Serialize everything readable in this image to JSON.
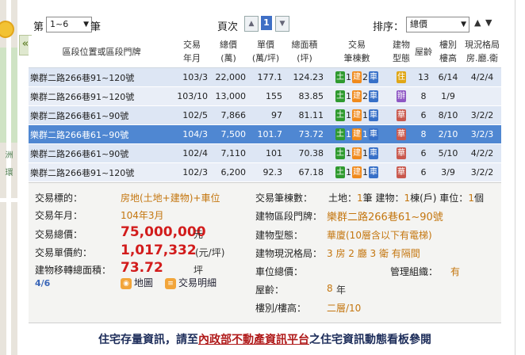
{
  "toolbar": {
    "page_prefix": "第",
    "page_range": "1~6",
    "page_suffix": "筆",
    "page_label": "頁次",
    "page_prev": "▲",
    "page_current": "1",
    "page_next": "▼",
    "sort_label": "排序：",
    "sort_value": "總價",
    "sort_asc": "▲",
    "sort_desc": "▼"
  },
  "columns": {
    "address": "區段位置或區段門牌",
    "date": [
      "交易",
      "年月"
    ],
    "total": [
      "總價",
      "(萬)"
    ],
    "unit_price": [
      "單價",
      "(萬/坪)"
    ],
    "area": [
      "總面積",
      "(坪)"
    ],
    "trans": [
      "交易",
      "筆棟數"
    ],
    "type": [
      "建物",
      "型態"
    ],
    "age": "屋齡",
    "floor": [
      "樓別",
      "樓高"
    ],
    "layout": [
      "現況格局",
      "房.廳.衛"
    ]
  },
  "rows": [
    {
      "address": "樂群二路266巷91~120號",
      "date": "103/3",
      "total": "22,000",
      "unit_price": "177.1",
      "area": "124.23",
      "land": "1",
      "land_tag": "土",
      "bldg": "2",
      "bldg_tag": "建",
      "car": "1",
      "car_tag": "車",
      "type_tag": "住",
      "age": "13",
      "floor": "6/14",
      "layout": "4/2/4"
    },
    {
      "address": "樂群二路266巷91~120號",
      "date": "103/10",
      "total": "13,000",
      "unit_price": "155",
      "area": "83.85",
      "land": "1",
      "land_tag": "土",
      "bldg": "2",
      "bldg_tag": "建",
      "car": "1",
      "car_tag": "車",
      "type_tag": "辦",
      "age": "8",
      "floor": "1/9",
      "layout": ""
    },
    {
      "address": "樂群二路266巷61~90號",
      "date": "102/5",
      "total": "7,866",
      "unit_price": "97",
      "area": "81.11",
      "land": "1",
      "land_tag": "土",
      "bldg": "1",
      "bldg_tag": "建",
      "car": "1",
      "car_tag": "車",
      "type_tag": "華",
      "age": "6",
      "floor": "8/10",
      "layout": "3/2/2"
    },
    {
      "address": "樂群二路266巷61~90號",
      "date": "104/3",
      "total": "7,500",
      "unit_price": "101.7",
      "area": "73.72",
      "land": "1",
      "land_tag": "土",
      "bldg": "1",
      "bldg_tag": "建",
      "car": "1",
      "car_tag": "車",
      "type_tag": "華",
      "age": "8",
      "floor": "2/10",
      "layout": "3/2/3"
    },
    {
      "address": "樂群二路266巷61~90號",
      "date": "102/4",
      "total": "7,110",
      "unit_price": "101",
      "area": "70.38",
      "land": "1",
      "land_tag": "土",
      "bldg": "1",
      "bldg_tag": "建",
      "car": "1",
      "car_tag": "車",
      "type_tag": "華",
      "age": "6",
      "floor": "5/10",
      "layout": "4/2/2"
    },
    {
      "address": "樂群二路266巷91~120號",
      "date": "102/3",
      "total": "6,200",
      "unit_price": "92.3",
      "area": "67.18",
      "land": "1",
      "land_tag": "土",
      "bldg": "1",
      "bldg_tag": "建",
      "car": "1",
      "car_tag": "車",
      "type_tag": "華",
      "age": "6",
      "floor": "3/9",
      "layout": "3/2/2"
    }
  ],
  "detail": {
    "target_label": "交易標的：",
    "target_value": "房地(土地+建物)+車位",
    "date_label": "交易年月：",
    "date_value": "104年3月",
    "total_label": "交易總價：",
    "total_value": "75,000,000",
    "total_unit": "元",
    "unit_label": "交易單價約：",
    "unit_value": "1,017,332",
    "unit_unit": "(元/坪)",
    "area_label": "建物移轉總面積：",
    "area_value": "73.72",
    "area_unit": "坪",
    "pager": "4/6",
    "map_btn": "地圖",
    "detail_btn": "交易明細",
    "count_label": "交易筆棟數：",
    "count_land_label": "土地：",
    "count_land": "1",
    "count_land_unit": "筆 建物：",
    "count_bldg": "1",
    "count_bldg_unit": "棟(戶) 車位：",
    "count_car": "1",
    "count_car_unit": "個",
    "addr_label": "建物區段門牌：",
    "addr_value": "樂群二路266巷61~90號",
    "type_label": "建物型態：",
    "type_value": "華廈(10層含以下有電梯)",
    "layout_label": "建物現況格局：",
    "layout_value": "3 房 2 廳 3 衛 有隔間",
    "parking_label": "車位總價：",
    "mgmt_label": "管理組織：",
    "mgmt_value": "有",
    "age_label": "屋齡：",
    "age_value": "8",
    "age_unit": "年",
    "floor_label": "樓別/樓高：",
    "floor_value": "二層/10"
  },
  "footer": {
    "prefix": "住宅存量資訊，請至",
    "link": "內政部不動產資訊平台",
    "suffix": "之住宅資訊動態看板參閱"
  },
  "map": {
    "label_1": "洲",
    "label_2": "環"
  }
}
